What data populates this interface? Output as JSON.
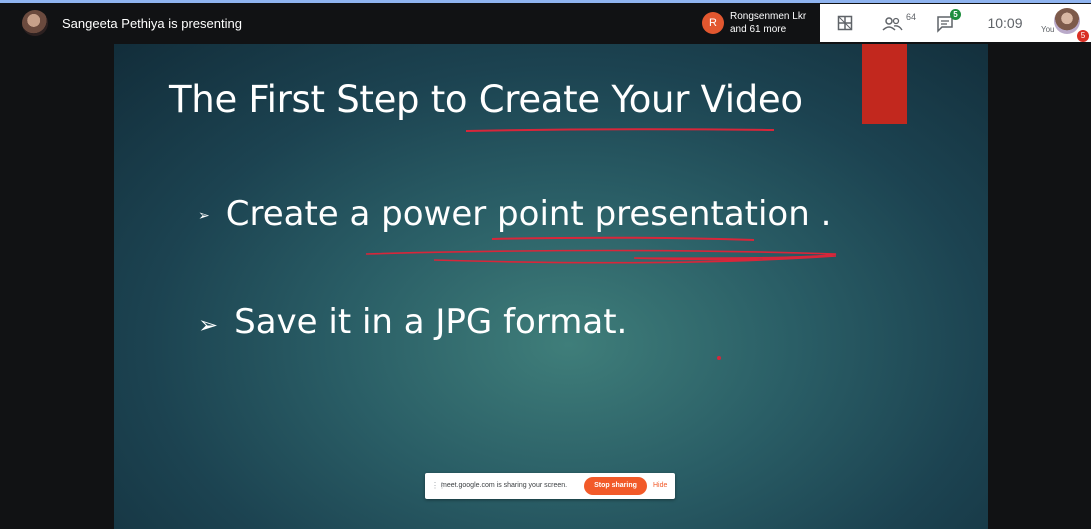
{
  "topbar": {
    "presenter_text": "Sangeeta Pethiya is presenting",
    "participant_initial": "R",
    "participant_name": "Rongsenmen Lkr",
    "participant_more": "and 61 more",
    "people_count": "64",
    "chat_badge": "5",
    "time": "10:09",
    "you_label": "You",
    "self_badge": "5"
  },
  "slide": {
    "title": "The  First Step to Create Your Video",
    "bullets": [
      {
        "marker": "➢",
        "text": "Create a power point  presentation ."
      },
      {
        "marker": "➢",
        "text": "Save it  in a JPG format."
      }
    ]
  },
  "share_bar": {
    "handle": "⋮⋮",
    "text": "meet.google.com is sharing your screen.",
    "stop_label": "Stop sharing",
    "hide_label": "Hide"
  },
  "icons": [
    "presenter-avatar",
    "layout-icon",
    "people-icon",
    "chat-icon",
    "self-avatar"
  ],
  "colors": {
    "accent_red": "#c2281e",
    "stop_orange": "#f25a29",
    "chat_green": "#1e8e3e",
    "annotation_red": "#d8263a"
  }
}
